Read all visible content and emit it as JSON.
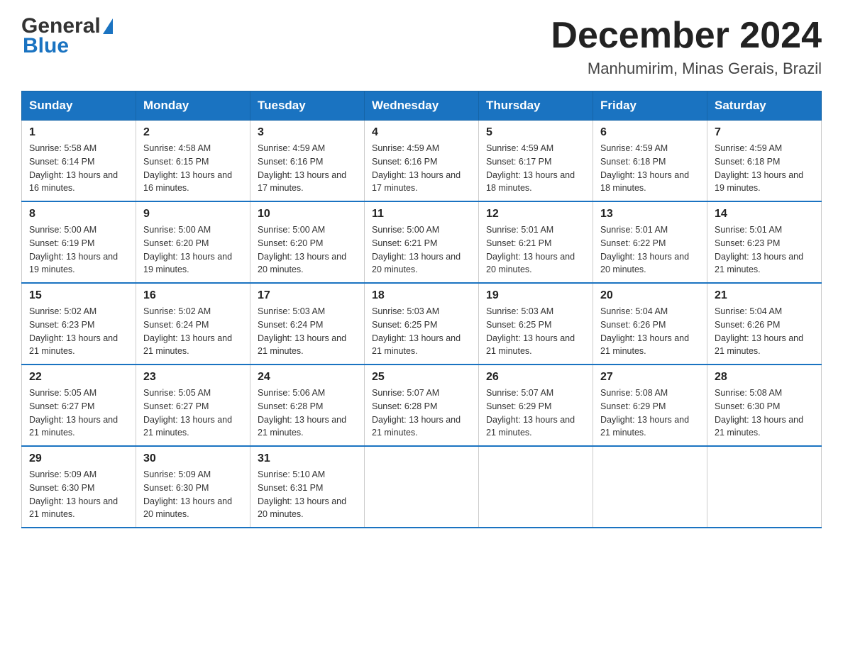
{
  "header": {
    "title": "December 2024",
    "subtitle": "Manhumirim, Minas Gerais, Brazil",
    "logo_general": "General",
    "logo_blue": "Blue"
  },
  "days_of_week": [
    "Sunday",
    "Monday",
    "Tuesday",
    "Wednesday",
    "Thursday",
    "Friday",
    "Saturday"
  ],
  "weeks": [
    [
      {
        "day": "1",
        "sunrise": "5:58 AM",
        "sunset": "6:14 PM",
        "daylight": "13 hours and 16 minutes."
      },
      {
        "day": "2",
        "sunrise": "4:58 AM",
        "sunset": "6:15 PM",
        "daylight": "13 hours and 16 minutes."
      },
      {
        "day": "3",
        "sunrise": "4:59 AM",
        "sunset": "6:16 PM",
        "daylight": "13 hours and 17 minutes."
      },
      {
        "day": "4",
        "sunrise": "4:59 AM",
        "sunset": "6:16 PM",
        "daylight": "13 hours and 17 minutes."
      },
      {
        "day": "5",
        "sunrise": "4:59 AM",
        "sunset": "6:17 PM",
        "daylight": "13 hours and 18 minutes."
      },
      {
        "day": "6",
        "sunrise": "4:59 AM",
        "sunset": "6:18 PM",
        "daylight": "13 hours and 18 minutes."
      },
      {
        "day": "7",
        "sunrise": "4:59 AM",
        "sunset": "6:18 PM",
        "daylight": "13 hours and 19 minutes."
      }
    ],
    [
      {
        "day": "8",
        "sunrise": "5:00 AM",
        "sunset": "6:19 PM",
        "daylight": "13 hours and 19 minutes."
      },
      {
        "day": "9",
        "sunrise": "5:00 AM",
        "sunset": "6:20 PM",
        "daylight": "13 hours and 19 minutes."
      },
      {
        "day": "10",
        "sunrise": "5:00 AM",
        "sunset": "6:20 PM",
        "daylight": "13 hours and 20 minutes."
      },
      {
        "day": "11",
        "sunrise": "5:00 AM",
        "sunset": "6:21 PM",
        "daylight": "13 hours and 20 minutes."
      },
      {
        "day": "12",
        "sunrise": "5:01 AM",
        "sunset": "6:21 PM",
        "daylight": "13 hours and 20 minutes."
      },
      {
        "day": "13",
        "sunrise": "5:01 AM",
        "sunset": "6:22 PM",
        "daylight": "13 hours and 20 minutes."
      },
      {
        "day": "14",
        "sunrise": "5:01 AM",
        "sunset": "6:23 PM",
        "daylight": "13 hours and 21 minutes."
      }
    ],
    [
      {
        "day": "15",
        "sunrise": "5:02 AM",
        "sunset": "6:23 PM",
        "daylight": "13 hours and 21 minutes."
      },
      {
        "day": "16",
        "sunrise": "5:02 AM",
        "sunset": "6:24 PM",
        "daylight": "13 hours and 21 minutes."
      },
      {
        "day": "17",
        "sunrise": "5:03 AM",
        "sunset": "6:24 PM",
        "daylight": "13 hours and 21 minutes."
      },
      {
        "day": "18",
        "sunrise": "5:03 AM",
        "sunset": "6:25 PM",
        "daylight": "13 hours and 21 minutes."
      },
      {
        "day": "19",
        "sunrise": "5:03 AM",
        "sunset": "6:25 PM",
        "daylight": "13 hours and 21 minutes."
      },
      {
        "day": "20",
        "sunrise": "5:04 AM",
        "sunset": "6:26 PM",
        "daylight": "13 hours and 21 minutes."
      },
      {
        "day": "21",
        "sunrise": "5:04 AM",
        "sunset": "6:26 PM",
        "daylight": "13 hours and 21 minutes."
      }
    ],
    [
      {
        "day": "22",
        "sunrise": "5:05 AM",
        "sunset": "6:27 PM",
        "daylight": "13 hours and 21 minutes."
      },
      {
        "day": "23",
        "sunrise": "5:05 AM",
        "sunset": "6:27 PM",
        "daylight": "13 hours and 21 minutes."
      },
      {
        "day": "24",
        "sunrise": "5:06 AM",
        "sunset": "6:28 PM",
        "daylight": "13 hours and 21 minutes."
      },
      {
        "day": "25",
        "sunrise": "5:07 AM",
        "sunset": "6:28 PM",
        "daylight": "13 hours and 21 minutes."
      },
      {
        "day": "26",
        "sunrise": "5:07 AM",
        "sunset": "6:29 PM",
        "daylight": "13 hours and 21 minutes."
      },
      {
        "day": "27",
        "sunrise": "5:08 AM",
        "sunset": "6:29 PM",
        "daylight": "13 hours and 21 minutes."
      },
      {
        "day": "28",
        "sunrise": "5:08 AM",
        "sunset": "6:30 PM",
        "daylight": "13 hours and 21 minutes."
      }
    ],
    [
      {
        "day": "29",
        "sunrise": "5:09 AM",
        "sunset": "6:30 PM",
        "daylight": "13 hours and 21 minutes."
      },
      {
        "day": "30",
        "sunrise": "5:09 AM",
        "sunset": "6:30 PM",
        "daylight": "13 hours and 20 minutes."
      },
      {
        "day": "31",
        "sunrise": "5:10 AM",
        "sunset": "6:31 PM",
        "daylight": "13 hours and 20 minutes."
      },
      null,
      null,
      null,
      null
    ]
  ],
  "accent_color": "#1a73c1"
}
